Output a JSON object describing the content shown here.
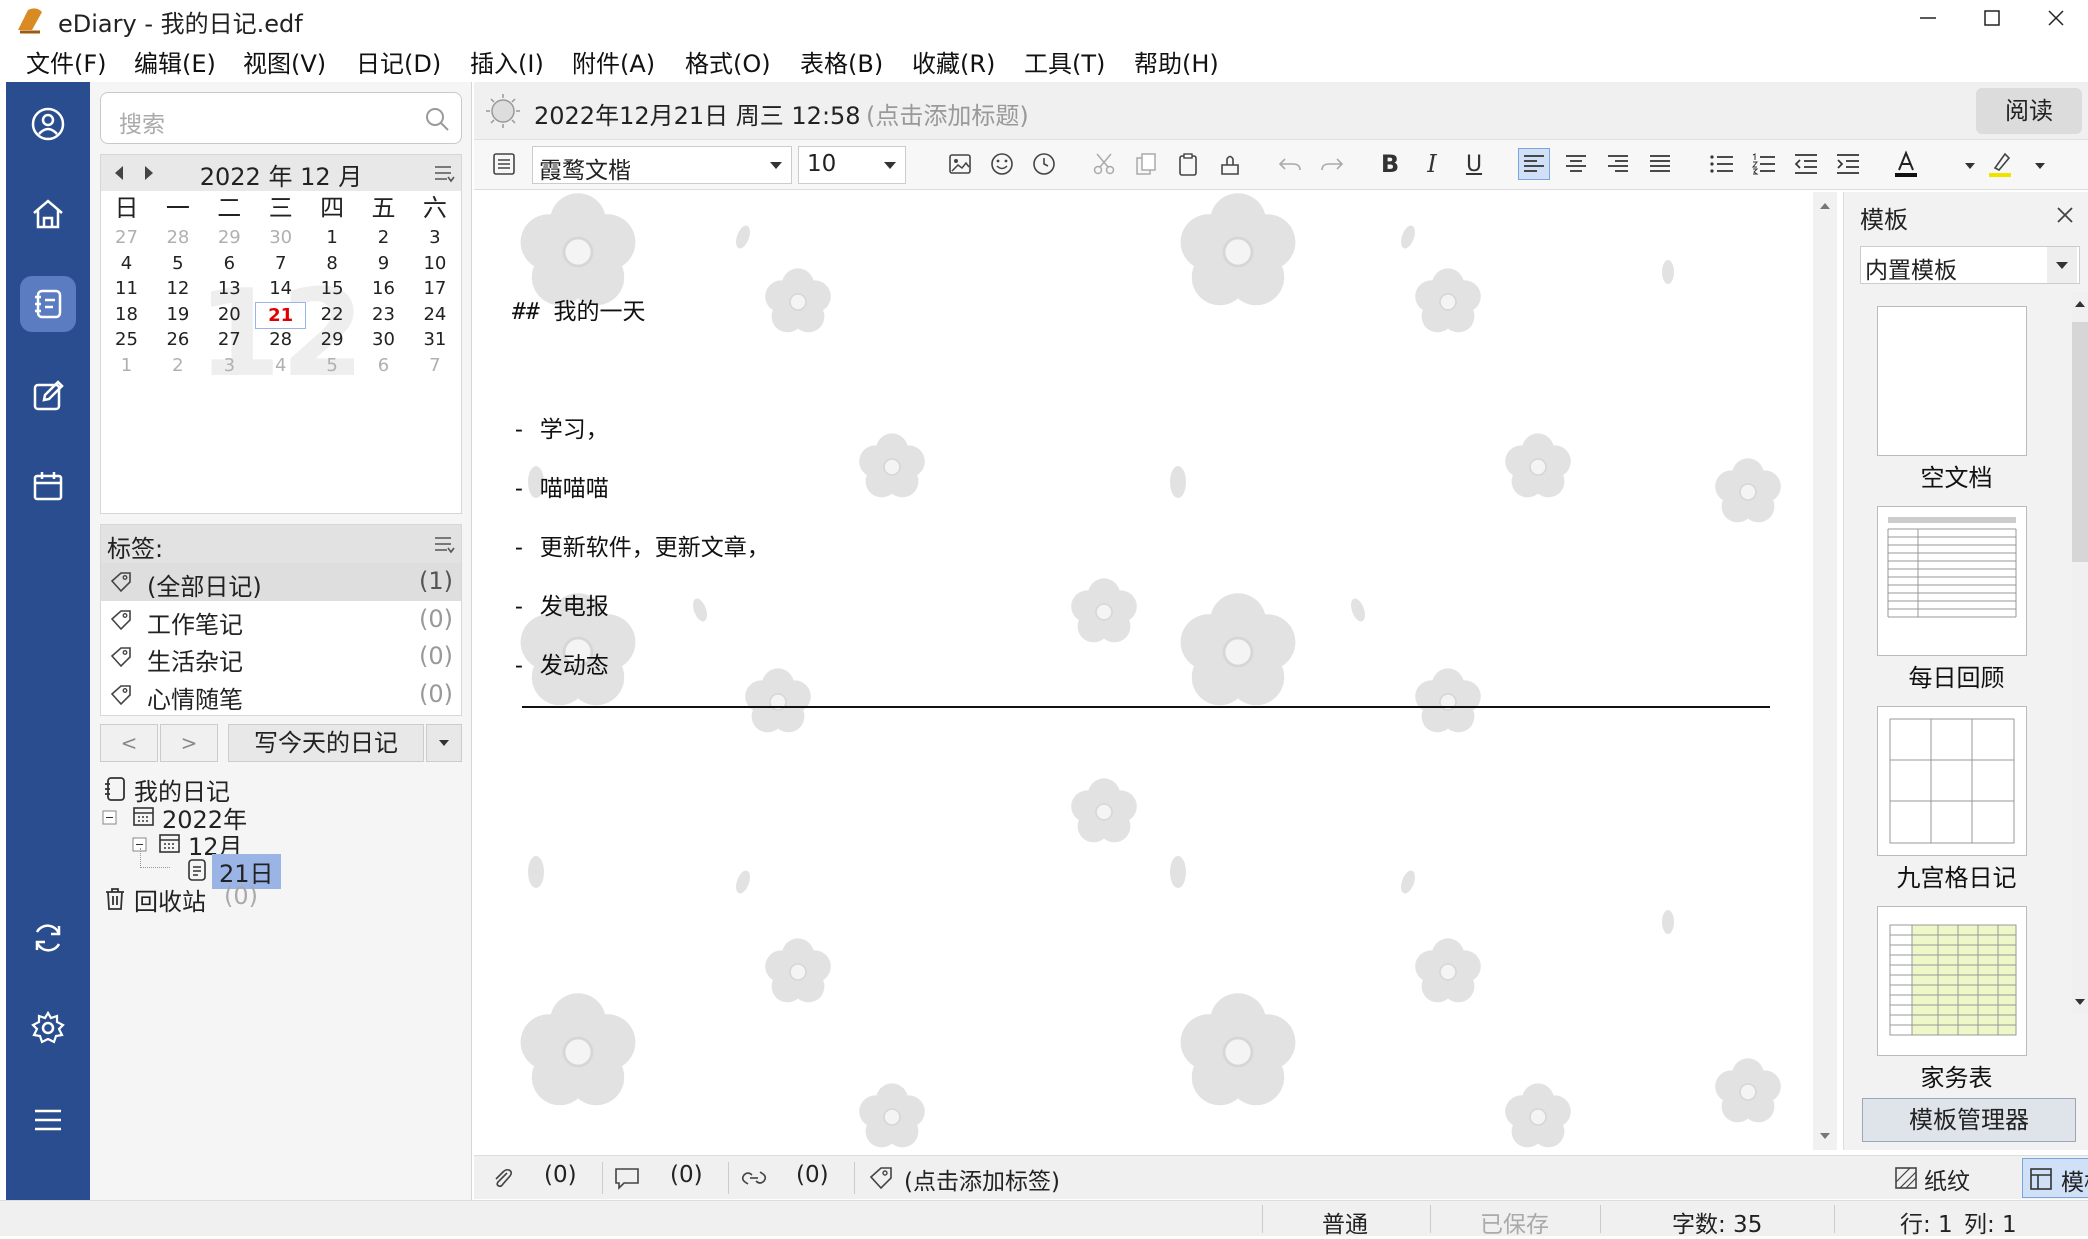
{
  "window": {
    "title": "eDiary - 我的日记.edf"
  },
  "menu": [
    "文件(F)",
    "编辑(E)",
    "视图(V)",
    "日记(D)",
    "插入(I)",
    "附件(A)",
    "格式(O)",
    "表格(B)",
    "收藏(R)",
    "工具(T)",
    "帮助(H)"
  ],
  "search": {
    "placeholder": "搜索"
  },
  "calendar": {
    "month_label": "2022 年 12 月",
    "watermark": "12",
    "weekdays": [
      "日",
      "一",
      "二",
      "三",
      "四",
      "五",
      "六"
    ],
    "weeks": [
      [
        "27",
        "28",
        "29",
        "30",
        "1",
        "2",
        "3"
      ],
      [
        "4",
        "5",
        "6",
        "7",
        "8",
        "9",
        "10"
      ],
      [
        "11",
        "12",
        "13",
        "14",
        "15",
        "16",
        "17"
      ],
      [
        "18",
        "19",
        "20",
        "21",
        "22",
        "23",
        "24"
      ],
      [
        "25",
        "26",
        "27",
        "28",
        "29",
        "30",
        "31"
      ],
      [
        "1",
        "2",
        "3",
        "4",
        "5",
        "6",
        "7"
      ]
    ],
    "today": "21",
    "today_color": "#e00000"
  },
  "tags": {
    "header": "标签:",
    "items": [
      {
        "label": "(全部日记)",
        "count": "(1)"
      },
      {
        "label": "工作笔记",
        "count": "(0)"
      },
      {
        "label": "生活杂记",
        "count": "(0)"
      },
      {
        "label": "心情随笔",
        "count": "(0)"
      }
    ]
  },
  "nav": {
    "prev": "<",
    "next": ">",
    "write_today": "写今天的日记"
  },
  "tree": {
    "root": "我的日记",
    "year": "2022年",
    "month": "12月",
    "day": "21日",
    "trash": "回收站",
    "trash_count": "(0)"
  },
  "entry": {
    "datetime": "2022年12月21日 周三 12:58",
    "title_placeholder": "(点击添加标题)",
    "read_button": "阅读"
  },
  "toolbar": {
    "font": "霞鹜文楷",
    "size": "10"
  },
  "content": {
    "lines": [
      "## 我的一天",
      "- 学习，",
      "- 喵喵喵",
      "- 更新软件，更新文章，",
      "- 发电报",
      "- 发动态"
    ]
  },
  "templates": {
    "header": "模板",
    "selected": "内置模板",
    "items": [
      "空文档",
      "每日回顾",
      "九宫格日记",
      "家务表"
    ],
    "manager_button": "模板管理器"
  },
  "bottom": {
    "attach_count": "(0)",
    "comment_count": "(0)",
    "link_count": "(0)",
    "tag_placeholder": "(点击添加标签)",
    "paper": "纸纹",
    "template": "模板"
  },
  "status": {
    "mode": "普通",
    "saved": "已保存",
    "word_count": "字数: 35",
    "row": "行: 1",
    "col": "列: 1"
  },
  "colors": {
    "rail": "#2a4d8f",
    "selection": "#9bb4e6",
    "accent": "#2a4d8f"
  }
}
